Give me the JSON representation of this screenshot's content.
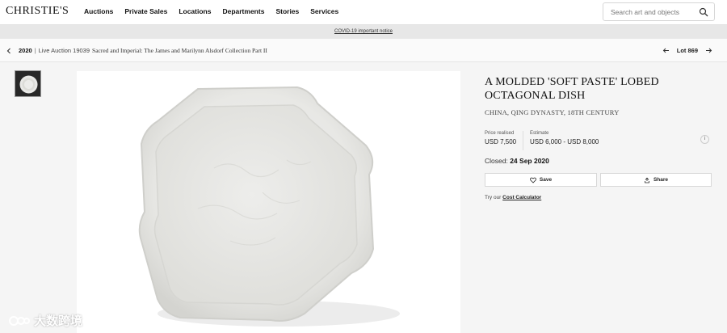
{
  "header": {
    "logo": "CHRISTIE'S",
    "nav": [
      "Auctions",
      "Private Sales",
      "Locations",
      "Departments",
      "Stories",
      "Services"
    ],
    "search_placeholder": "Search art and objects"
  },
  "banner": {
    "text": "COVID-19 important notice"
  },
  "breadcrumb": {
    "year": "2020",
    "separator": "|",
    "sale": "Live Auction 19039",
    "title": "Sacred and Imperial: The James and Marilynn Alsdorf Collection Part II",
    "lot": "Lot 869"
  },
  "lot": {
    "title": "A MOLDED 'SOFT PASTE' LOBED OCTAGONAL DISH",
    "subtitle": "CHINA, QING DYNASTY, 18TH CENTURY",
    "price_realised_label": "Price realised",
    "price_realised_value": "USD 7,500",
    "estimate_label": "Estimate",
    "estimate_value": "USD 6,000 - USD 8,000",
    "closed_label": "Closed:",
    "closed_date": "24 Sep 2020",
    "save_label": "Save",
    "share_label": "Share",
    "calc_prefix": "Try our",
    "calc_link": "Cost Calculator",
    "info_glyph": "i"
  },
  "watermark": {
    "text": "大数跨境"
  },
  "icons": {
    "search": "search-icon",
    "prev": "chevron-left-icon",
    "next": "chevron-right-icon",
    "save": "heart-icon",
    "share": "share-icon"
  }
}
